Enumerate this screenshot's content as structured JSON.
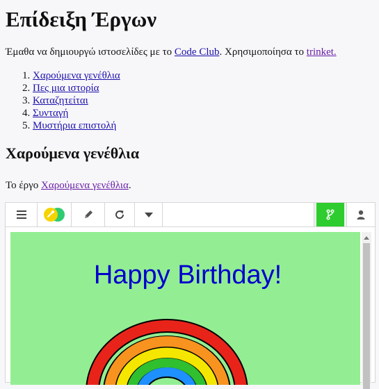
{
  "page": {
    "title": "Επίδειξη Έργων",
    "intro": {
      "prefix": "Έμαθα να δημιουργώ ιστοσελίδες με το ",
      "code_club_link": "Code Club",
      "middle": ". Χρησιμοποίησα το ",
      "trinket_link": "trinket."
    },
    "projects": [
      {
        "number": "1.",
        "label": "Χαρούμενα γενέθλια"
      },
      {
        "number": "2.",
        "label": "Πες μια ιστορία"
      },
      {
        "number": "3.",
        "label": "Καταζητείται"
      },
      {
        "number": "4.",
        "label": "Συνταγή"
      },
      {
        "number": "5.",
        "label": "Μυστήρια επιστολή"
      }
    ],
    "section": {
      "heading": "Χαρούμενα γενέθλια",
      "desc_prefix": "Το έργο ",
      "desc_link": "Χαρούμενα γενέθλια",
      "desc_suffix": "."
    }
  },
  "trinket": {
    "toolbar": {
      "menu_icon": "hamburger-menu-icon",
      "toggle_icon": "code-result-toggle-icon",
      "pencil_icon": "pencil-icon",
      "reload_icon": "reload-icon",
      "caret_icon": "caret-down-icon",
      "remix_icon": "fork-icon",
      "user_icon": "user-icon"
    },
    "output": {
      "greeting": "Happy Birthday!",
      "background": "#93ee93",
      "greeting_color": "#0000cd"
    }
  },
  "colors": {
    "link": "#1a0dab",
    "visited_link": "#681da8",
    "remix_green": "#2ecc2e",
    "toggle_yellow": "#f5d400",
    "toggle_green": "#2ecc71"
  }
}
